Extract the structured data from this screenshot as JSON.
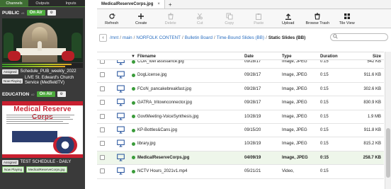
{
  "left": {
    "tabs": [
      "Channels",
      "Outputs",
      "Inputs"
    ],
    "channel1": {
      "name": "PUBLIC",
      "sub": "#1",
      "onair": "On Air",
      "assigned_label": "Assigned",
      "assigned_value": "Schedule_PUB_weekly_2022",
      "nowplaying_label": "Now Playing",
      "nowplaying_value": "LIVE St. Edward's Church Service (MedfieldTV)"
    },
    "channel2": {
      "name": "EDUCATION",
      "sub": "#2",
      "onair": "On Air",
      "slide_title": "Medical Reserve Corps",
      "assigned_label": "Assigned",
      "assigned_value": "TEST SCHEDULE - DAILY",
      "nowplaying_label": "Now Playing",
      "nowplaying_value": "MedicalReserveCorps.jpg"
    }
  },
  "right": {
    "file_tab": "MedicalReserveCorps.jpg",
    "file_tab_close": "×",
    "file_tab_add": "+",
    "toolbar": {
      "refresh": "Refresh",
      "create": "Create",
      "delete": "Delete",
      "cut": "Cut",
      "copy": "Copy",
      "paste": "Paste",
      "upload": "Upload",
      "browse_trash": "Browse Trash",
      "tile_view": "Tile View"
    },
    "path": {
      "root": "/mnt",
      "main": "main",
      "norfolk": "NORFOLK CONTENT",
      "bulletin": "Bulletin Board",
      "timebound": "Time-Bound Slides (BB)",
      "current": "Static Slides (BB)"
    },
    "columns": {
      "filename": "Filename",
      "date": "Date",
      "type": "Type",
      "duration": "Duration",
      "size": "Size"
    },
    "files": [
      {
        "name": "COA_fuel assistance.jpg",
        "date": "09/28/17",
        "type": "Image, JPEG",
        "duration": "0:15",
        "size": "542 KB"
      },
      {
        "name": "DogLicense.jpg",
        "date": "09/28/17",
        "type": "Image, JPEG",
        "duration": "0:15",
        "size": "911.6 KB"
      },
      {
        "name": "FCoN_pancakebreakfast.jpg",
        "date": "09/28/17",
        "type": "Image, JPEG",
        "duration": "0:15",
        "size": "302.6 KB"
      },
      {
        "name": "GATRA_tritownconnector.jpg",
        "date": "09/28/17",
        "type": "Image, JPEG",
        "duration": "0:15",
        "size": "830.9 KB"
      },
      {
        "name": "GovtMeeting-VoiceSynthesis.jpg",
        "date": "10/28/19",
        "type": "Image, JPEG",
        "duration": "0:15",
        "size": "1.9 MB"
      },
      {
        "name": "KP-Bottles&Cans.jpg",
        "date": "09/15/20",
        "type": "Image, JPEG",
        "duration": "0:15",
        "size": "911.8 KB"
      },
      {
        "name": "library.jpg",
        "date": "10/28/19",
        "type": "Image, JPEG",
        "duration": "0:15",
        "size": "815.2 KB"
      },
      {
        "name": "MedicalReserveCorps.jpg",
        "date": "04/09/19",
        "type": "Image, JPEG",
        "duration": "0:15",
        "size": "258.7 KB"
      },
      {
        "name": "NCTV Hours_2021v1.mp4",
        "date": "05/21/21",
        "type": "Video,",
        "duration": "0:15",
        "size": ""
      }
    ]
  }
}
